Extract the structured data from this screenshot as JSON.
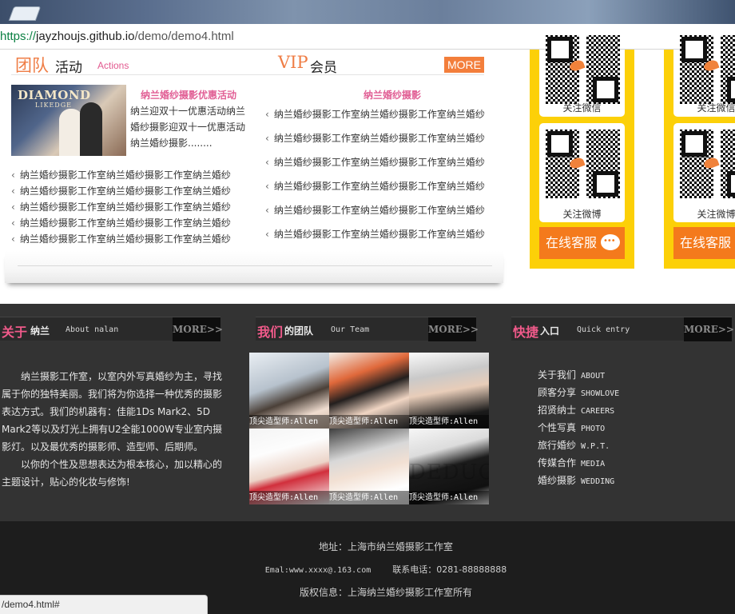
{
  "browser": {
    "url_scheme": "https://",
    "url_host": "jayzhoujs.github.io",
    "url_path": "/demo/demo4.html",
    "status_url": "/demo4.html#"
  },
  "activity": {
    "title_team": "团队",
    "title_activity": "活动",
    "title_actions": "Actions",
    "title_vip": "VIP",
    "title_member": "会员",
    "more_label": "MORE",
    "promo_brand": "DIAMOND",
    "promo_brand_sub": "LIKEDGE",
    "promo_title": "纳兰婚纱摄影优惠活动",
    "promo_desc": "纳兰迎双十一优惠活动纳兰婚纱摄影迎双十一优惠活动纳兰婚纱摄影........",
    "left_items": [
      "纳兰婚纱摄影工作室纳兰婚纱摄影工作室纳兰婚纱",
      "纳兰婚纱摄影工作室纳兰婚纱摄影工作室纳兰婚纱",
      "纳兰婚纱摄影工作室纳兰婚纱摄影工作室纳兰婚纱",
      "纳兰婚纱摄影工作室纳兰婚纱摄影工作室纳兰婚纱",
      "纳兰婚纱摄影工作室纳兰婚纱摄影工作室纳兰婚纱"
    ],
    "right_title": "纳兰婚纱摄影",
    "right_items": [
      "纳兰婚纱摄影工作室纳兰婚纱摄影工作室纳兰婚纱",
      "纳兰婚纱摄影工作室纳兰婚纱摄影工作室纳兰婚纱",
      "纳兰婚纱摄影工作室纳兰婚纱摄影工作室纳兰婚纱",
      "纳兰婚纱摄影工作室纳兰婚纱摄影工作室纳兰婚纱",
      "纳兰婚纱摄影工作室纳兰婚纱摄影工作室纳兰婚纱",
      "纳兰婚纱摄影工作室纳兰婚纱摄影工作室纳兰婚纱"
    ]
  },
  "side": {
    "wechat_label": "关注微信",
    "weibo_label": "关注微博",
    "chat_label": "在线客服"
  },
  "about": {
    "cn1": "关于",
    "cn2": "纳兰",
    "en": "About nalan",
    "more": "MORE>>",
    "para1": "纳兰摄影工作室，以室内外写真婚纱为主，寻找属于你的独特美丽。我们将为你选择一种优秀的摄影表达方式。我们的机器有：佳能1Ds Mark2、5D Mark2等以及灯光上拥有U2全能1000W专业室内摄影灯。以及最优秀的摄影师、造型师、后期师。",
    "para2": "以你的个性及思想表达为根本核心，加以精心的主题设计，贴心的化妆与修饰!"
  },
  "team": {
    "cn1": "我们",
    "cn2": "的团队",
    "en": "Our Team",
    "more": "MORE>>",
    "members": [
      "顶尖造型师:Allen",
      "顶尖造型师:Allen",
      "顶尖造型师:Allen",
      "顶尖造型师:Allen",
      "顶尖造型师:Allen",
      "顶尖造型师:Allen"
    ],
    "watermark": "DEDUCI"
  },
  "quick": {
    "cn1": "快捷",
    "cn2": "入口",
    "en": "Quick entry",
    "more": "MORE>>",
    "items": [
      {
        "cn": "关于我们",
        "en": "ABOUT"
      },
      {
        "cn": "顾客分享",
        "en": "SHOWLOVE"
      },
      {
        "cn": "招贤纳士",
        "en": "CAREERS"
      },
      {
        "cn": "个性写真",
        "en": "PHOTO"
      },
      {
        "cn": "旅行婚纱",
        "en": "W.P.T."
      },
      {
        "cn": "传媒合作",
        "en": "MEDIA"
      },
      {
        "cn": "婚纱摄影",
        "en": "WEDDING"
      }
    ]
  },
  "footer": {
    "address": "地址：上海市纳兰婚摄影工作室",
    "email_label": "Emal:",
    "email": "www.xxxx@.163.com",
    "phone": "联系电话：0281-88888888",
    "copyright": "版权信息：上海纳兰婚纱摄影工作室所有"
  },
  "colors": {
    "accent_orange": "#f37e3b",
    "accent_pink": "#e15f95",
    "qr_panel_yellow": "#fcd008",
    "dark_bg": "#333333"
  }
}
